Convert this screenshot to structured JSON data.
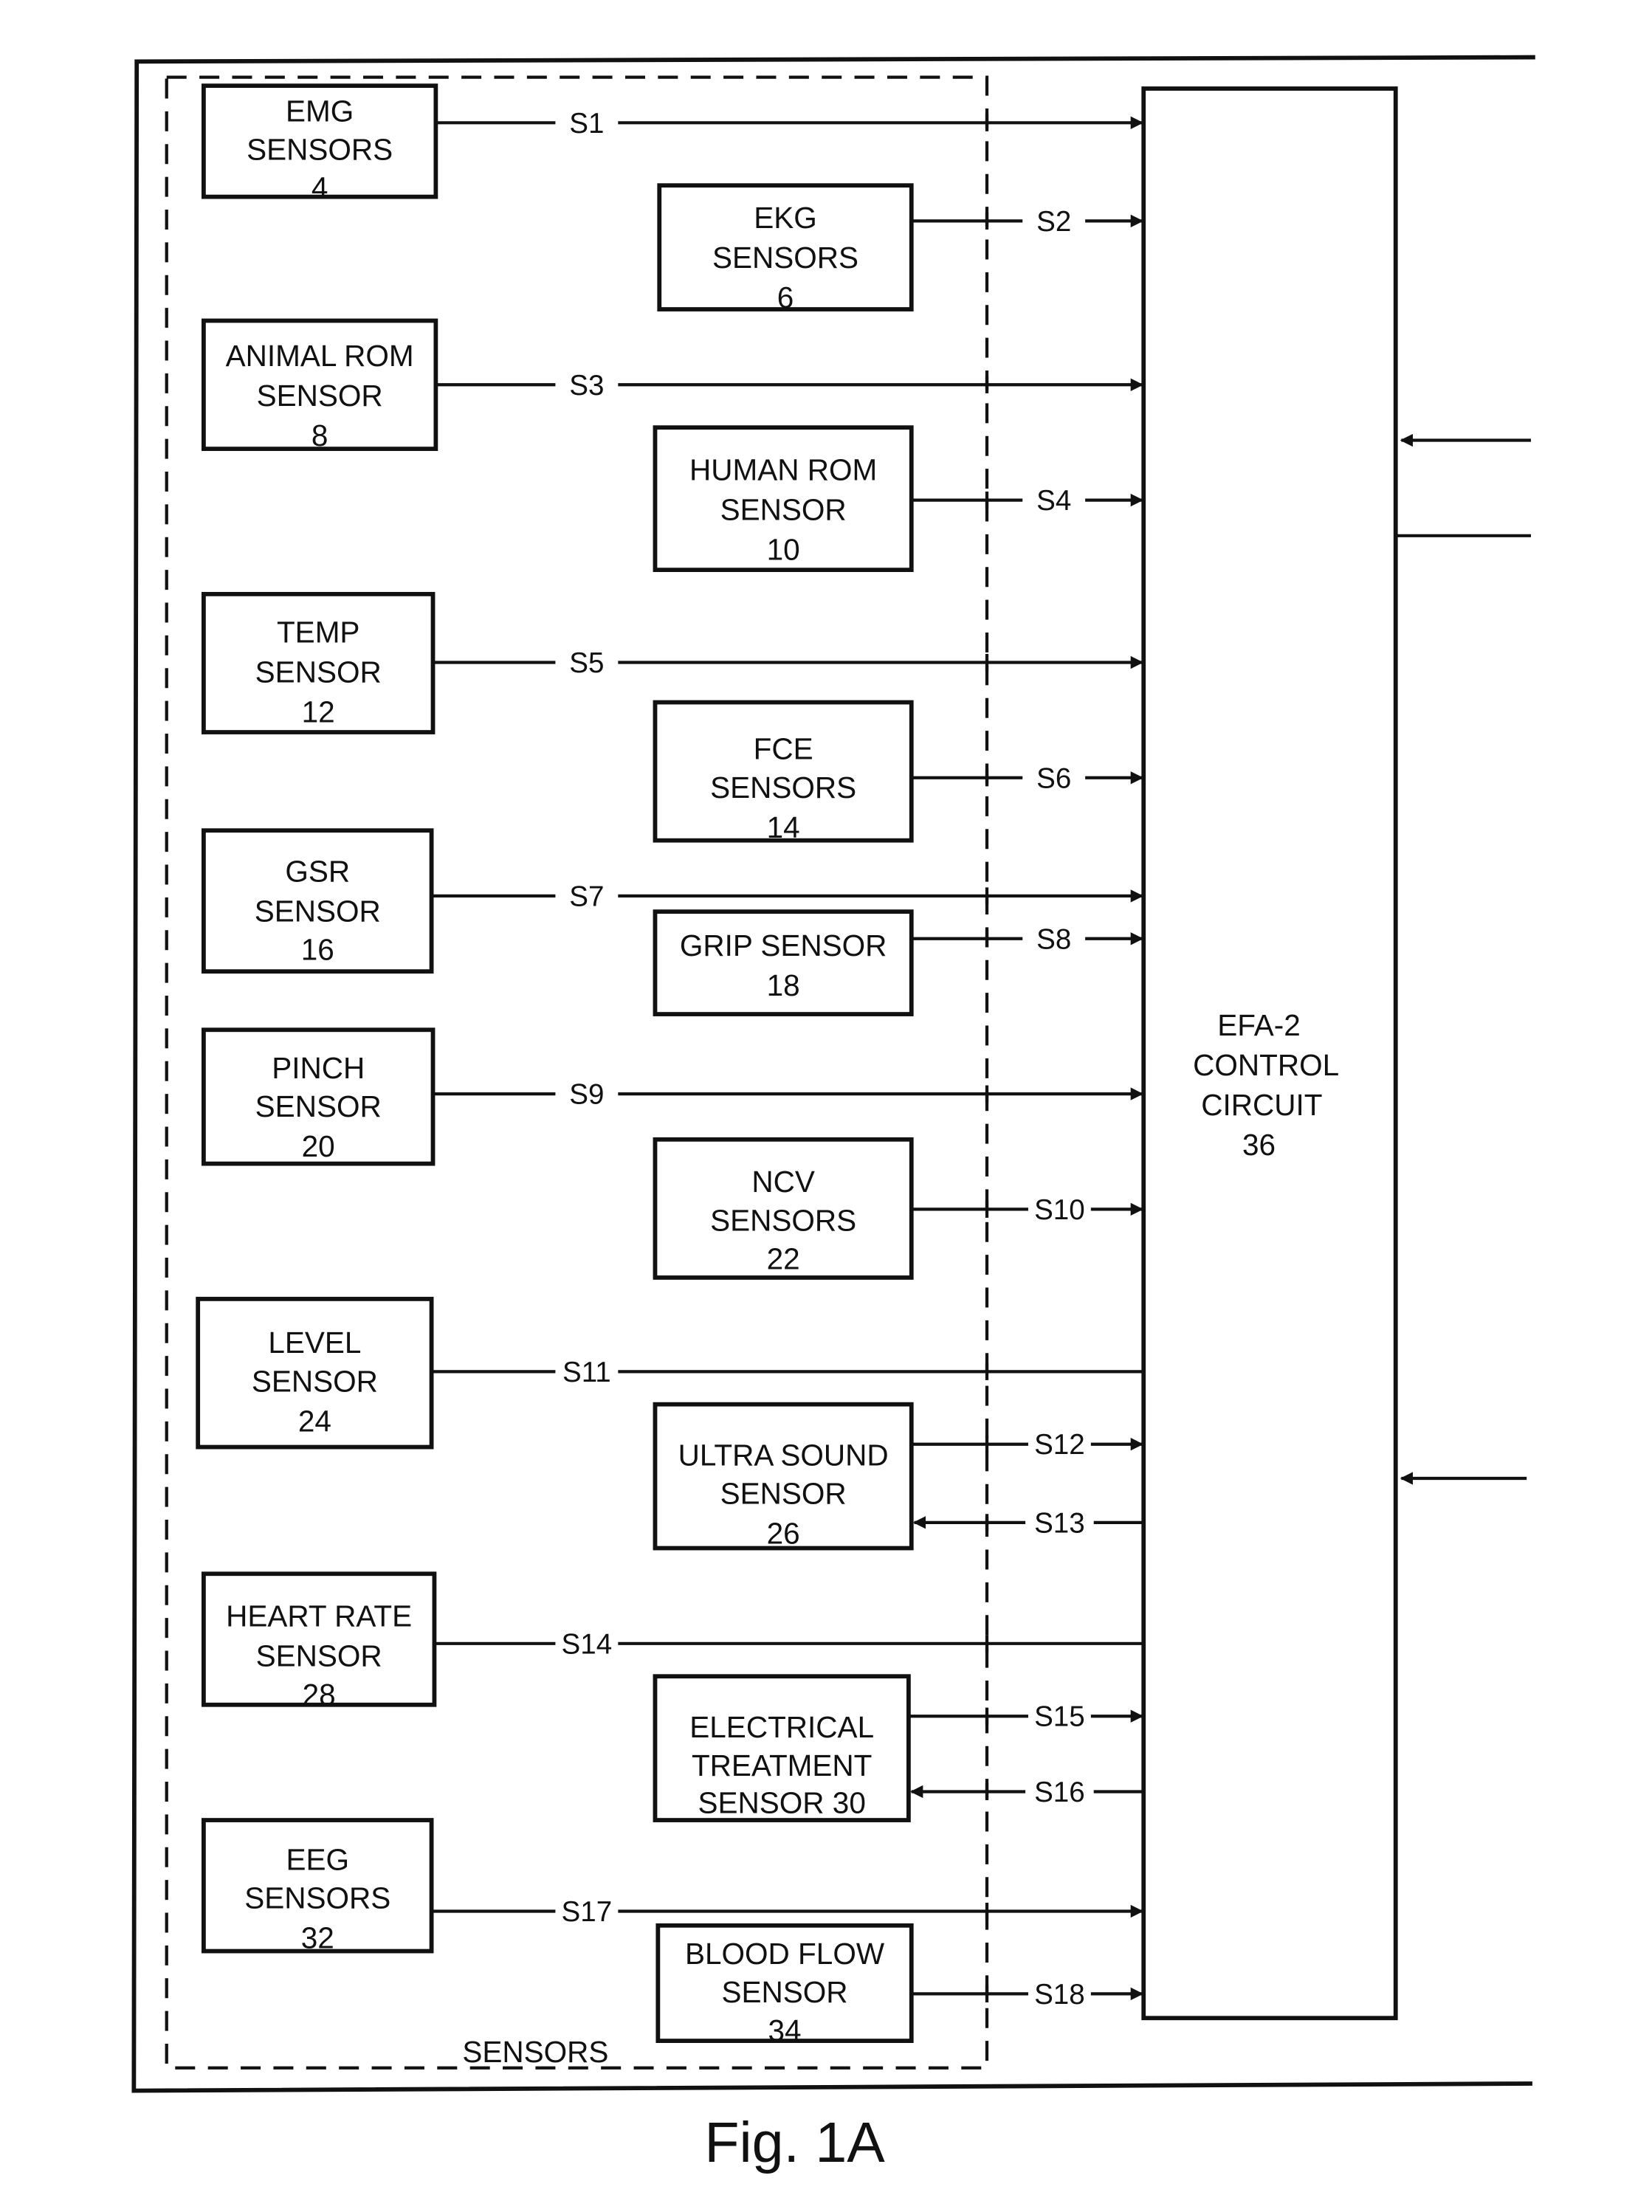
{
  "figure_label": "Fig. 1A",
  "sensors_group_label": "SENSORS",
  "control_circuit": {
    "lines": [
      "EFA-2",
      "CONTROL",
      "CIRCUIT",
      "36"
    ]
  },
  "sensors": [
    {
      "id": "emg",
      "lines": [
        "EMG",
        "SENSORS",
        "4"
      ],
      "signal": "S1",
      "column": "left"
    },
    {
      "id": "ekg",
      "lines": [
        "EKG",
        "SENSORS",
        "6"
      ],
      "signal": "S2",
      "column": "right"
    },
    {
      "id": "animal-rom",
      "lines": [
        "ANIMAL ROM",
        "SENSOR",
        "8"
      ],
      "signal": "S3",
      "column": "left"
    },
    {
      "id": "human-rom",
      "lines": [
        "HUMAN ROM",
        "SENSOR",
        "10"
      ],
      "signal": "S4",
      "column": "right"
    },
    {
      "id": "temp",
      "lines": [
        "TEMP",
        "SENSOR",
        "12"
      ],
      "signal": "S5",
      "column": "left"
    },
    {
      "id": "fce",
      "lines": [
        "FCE",
        "SENSORS",
        "14"
      ],
      "signal": "S6",
      "column": "right"
    },
    {
      "id": "gsr",
      "lines": [
        "GSR",
        "SENSOR",
        "16"
      ],
      "signal": "S7",
      "column": "left"
    },
    {
      "id": "grip",
      "lines": [
        "GRIP SENSOR",
        "18"
      ],
      "signal": "S8",
      "column": "right"
    },
    {
      "id": "pinch",
      "lines": [
        "PINCH",
        "SENSOR",
        "20"
      ],
      "signal": "S9",
      "column": "left"
    },
    {
      "id": "ncv",
      "lines": [
        "NCV",
        "SENSORS",
        "22"
      ],
      "signal": "S10",
      "column": "right"
    },
    {
      "id": "level",
      "lines": [
        "LEVEL",
        "SENSOR",
        "24"
      ],
      "signal": "S11",
      "column": "left"
    },
    {
      "id": "ultrasound",
      "lines": [
        "ULTRA SOUND",
        "SENSOR",
        "26"
      ],
      "signal": "S12",
      "return_signal": "S13",
      "column": "right"
    },
    {
      "id": "heart-rate",
      "lines": [
        "HEART RATE",
        "SENSOR",
        "28"
      ],
      "signal": "S14",
      "column": "left"
    },
    {
      "id": "electrical-treatment",
      "lines": [
        "ELECTRICAL",
        "TREATMENT",
        "SENSOR  30"
      ],
      "signal": "S15",
      "return_signal": "S16",
      "column": "right"
    },
    {
      "id": "eeg",
      "lines": [
        "EEG",
        "SENSORS",
        "32"
      ],
      "signal": "S17",
      "column": "left"
    },
    {
      "id": "blood-flow",
      "lines": [
        "BLOOD FLOW",
        "SENSOR",
        "34"
      ],
      "signal": "S18",
      "column": "right"
    }
  ]
}
